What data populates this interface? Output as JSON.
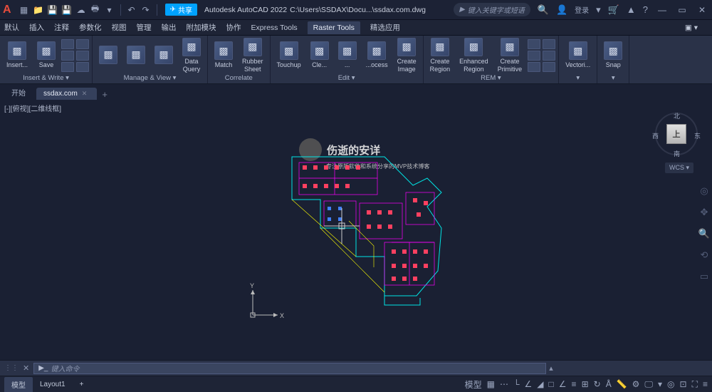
{
  "app": {
    "name": "Autodesk AutoCAD 2022",
    "file_path": "C:\\Users\\SSDAX\\Docu...\\ssdax.com.dwg",
    "logo_letter": "A"
  },
  "qat": {
    "share_label": "共享",
    "login_label": "登录"
  },
  "search": {
    "placeholder": "键入关键字或短语"
  },
  "menu": {
    "items": [
      "默认",
      "插入",
      "注释",
      "参数化",
      "视图",
      "管理",
      "输出",
      "附加模块",
      "协作",
      "Express Tools",
      "Raster Tools",
      "精选应用"
    ],
    "active_index": 10
  },
  "ribbon": {
    "panels": [
      {
        "title": "Insert & Write ▾",
        "buttons": [
          {
            "label": "Insert..."
          },
          {
            "label": "Save"
          }
        ],
        "small_cols": 2
      },
      {
        "title": "Manage & View ▾",
        "buttons": [
          {
            "label": ""
          },
          {
            "label": ""
          },
          {
            "label": ""
          },
          {
            "label": "Data\nQuery"
          }
        ],
        "small_cols": 0
      },
      {
        "title": "Correlate",
        "buttons": [
          {
            "label": "Match"
          },
          {
            "label": "Rubber\nSheet"
          }
        ]
      },
      {
        "title": "Edit ▾",
        "buttons": [
          {
            "label": "Touchup"
          },
          {
            "label": "Cle..."
          },
          {
            "label": "..."
          },
          {
            "label": "...ocess"
          },
          {
            "label": "Create\nImage"
          }
        ]
      },
      {
        "title": "REM ▾",
        "buttons": [
          {
            "label": "Create\nRegion"
          },
          {
            "label": "Enhanced\nRegion"
          },
          {
            "label": "Create\nPrimitive"
          }
        ],
        "small_cols": 2
      },
      {
        "title": "▾",
        "buttons": [
          {
            "label": "Vectori..."
          }
        ]
      },
      {
        "title": "▾",
        "buttons": [
          {
            "label": "Snap"
          }
        ]
      }
    ]
  },
  "doc_tabs": {
    "tabs": [
      "开始",
      "ssdax.com"
    ],
    "active_index": 1
  },
  "canvas": {
    "view_label": "[-][俯视][二维线框]",
    "wcs": "WCS ▾"
  },
  "viewcube": {
    "face": "上",
    "dirs": {
      "n": "北",
      "e": "东",
      "s": "南",
      "w": "西"
    }
  },
  "ucs": {
    "x": "X",
    "y": "Y"
  },
  "watermark": {
    "title": "伤逝的安详",
    "sub": "专注原版软件和系统分享的MVP技术博客"
  },
  "command": {
    "placeholder": "键入命令",
    "chevron": "▶_"
  },
  "status": {
    "tabs": [
      "模型",
      "Layout1"
    ],
    "active_index": 0,
    "right_label": "模型"
  }
}
